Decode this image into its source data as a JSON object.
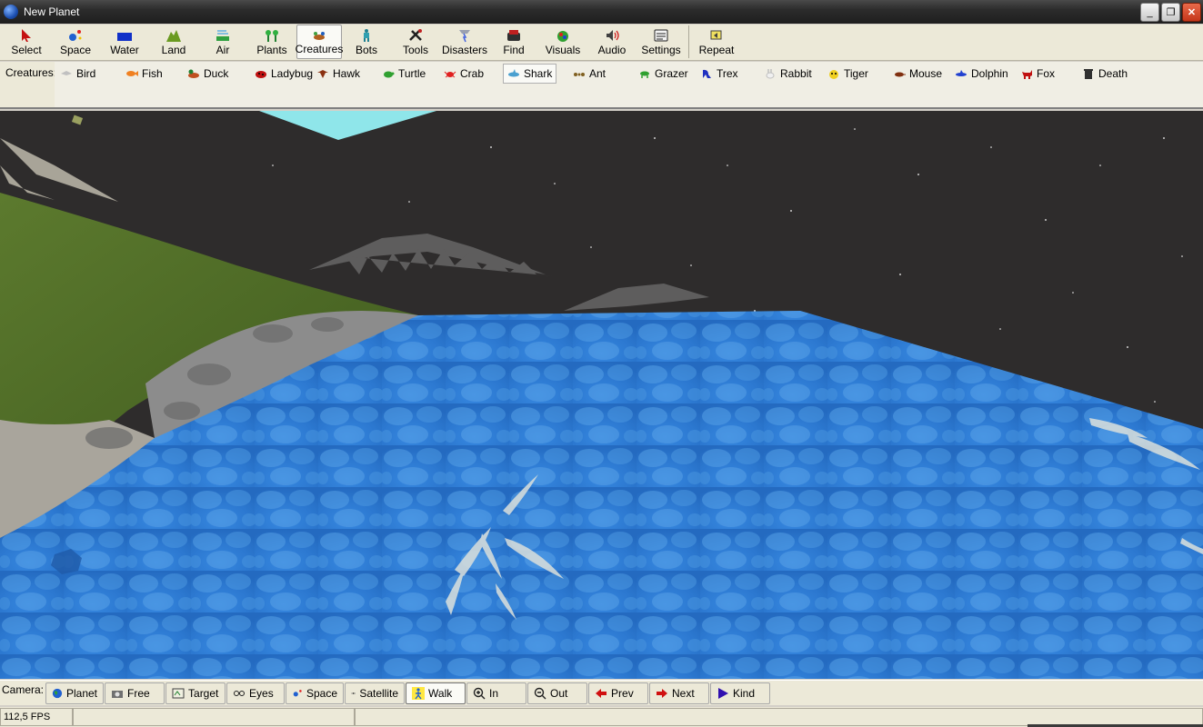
{
  "window": {
    "title": "New Planet",
    "minimize_label": "_",
    "restore_label": "❐",
    "close_label": "✕"
  },
  "toolbar": {
    "items": [
      {
        "label": "Select"
      },
      {
        "label": "Space"
      },
      {
        "label": "Water"
      },
      {
        "label": "Land"
      },
      {
        "label": "Air"
      },
      {
        "label": "Plants"
      },
      {
        "label": "Creatures"
      },
      {
        "label": "Bots"
      },
      {
        "label": "Tools"
      },
      {
        "label": "Disasters"
      },
      {
        "label": "Find"
      },
      {
        "label": "Visuals"
      },
      {
        "label": "Audio"
      },
      {
        "label": "Settings"
      },
      {
        "label": "Repeat"
      }
    ],
    "active": "Creatures"
  },
  "creatures": {
    "label": "Creatures:",
    "items": [
      {
        "label": "Bird"
      },
      {
        "label": "Fish"
      },
      {
        "label": "Duck"
      },
      {
        "label": "Ladybug"
      },
      {
        "label": "Hawk"
      },
      {
        "label": "Turtle"
      },
      {
        "label": "Crab"
      },
      {
        "label": "Shark"
      },
      {
        "label": "Ant"
      },
      {
        "label": "Grazer"
      },
      {
        "label": "Trex"
      },
      {
        "label": "Rabbit"
      },
      {
        "label": "Tiger"
      },
      {
        "label": "Mouse"
      },
      {
        "label": "Dolphin"
      },
      {
        "label": "Fox"
      },
      {
        "label": "Death"
      }
    ],
    "active": "Shark"
  },
  "camera": {
    "label": "Camera:",
    "buttons": [
      {
        "label": "Planet"
      },
      {
        "label": "Free"
      },
      {
        "label": "Target"
      },
      {
        "label": "Eyes"
      },
      {
        "label": "Space"
      },
      {
        "label": "Satellite"
      },
      {
        "label": "Walk"
      },
      {
        "label": "In"
      },
      {
        "label": "Out"
      },
      {
        "label": "Prev"
      },
      {
        "label": "Next"
      },
      {
        "label": "Kind"
      }
    ],
    "active": "Walk"
  },
  "status": {
    "fps": "112,5 FPS"
  },
  "colors": {
    "water": "#2f7fd6",
    "sky": "#2e2c2c",
    "grass": "#4f6b2a",
    "accent_close": "#d0401e"
  }
}
